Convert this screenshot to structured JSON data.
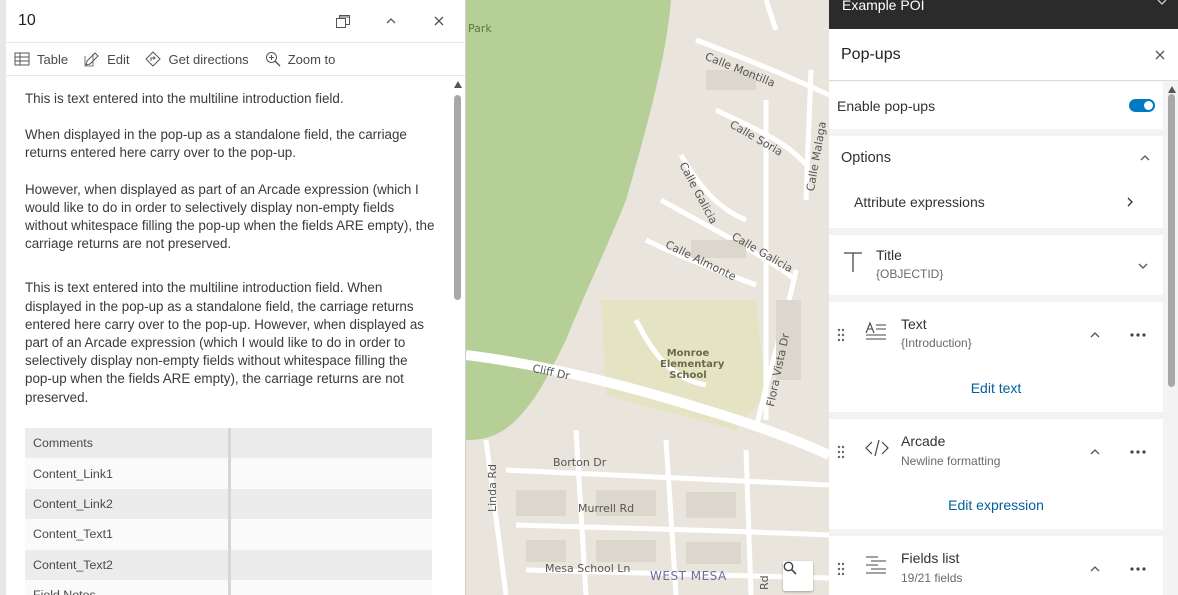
{
  "popup": {
    "title": "10",
    "toolbar": {
      "table": "Table",
      "edit": "Edit",
      "directions": "Get directions",
      "zoom": "Zoom to"
    },
    "intro_paragraphs": [
      "This is text entered into the multiline introduction field.",
      "When displayed in the pop-up as a standalone field, the carriage returns entered here carry over to the pop-up.",
      "However, when displayed as part of an Arcade expression (which I would like to do in order to selectively display non-empty fields without whitespace filling the pop-up when the fields ARE empty), the carriage returns are not preserved.",
      "This is text entered into the multiline introduction field. When displayed in the pop-up as a standalone field, the carriage returns entered here carry over to the pop-up. However, when displayed as part of an Arcade expression (which I would like to do in order to selectively display non-empty fields without whitespace filling the pop-up when the fields ARE empty), the carriage returns are not preserved."
    ],
    "fields": [
      {
        "name": "Comments",
        "value": ""
      },
      {
        "name": "Content_Link1",
        "value": ""
      },
      {
        "name": "Content_Link2",
        "value": ""
      },
      {
        "name": "Content_Text1",
        "value": ""
      },
      {
        "name": "Content_Text2",
        "value": ""
      },
      {
        "name": "Field Notes",
        "value": ""
      }
    ]
  },
  "map": {
    "labels": {
      "park": "Park",
      "calle_montilla": "Calle Montilla",
      "calle_soria": "Calle Soria",
      "calle_malaga": "Calle Malaga",
      "calle_galicia_v": "Calle Galicia",
      "calle_galicia": "Calle Galicia",
      "calle_almonte": "Calle Almonte",
      "flora_vista": "Flora Vista Dr",
      "school": "Monroe Elementary School",
      "cliff_dr": "Cliff Dr",
      "borton_dr": "Borton Dr",
      "linda_rd": "Linda Rd",
      "murrell_rd": "Murrell Rd",
      "mesa_school_ln": "Mesa School Ln",
      "west_mesa": "WEST MESA",
      "rd_bottom": "Rd"
    },
    "colors": {
      "park": "#b5cf96",
      "school": "#e4e3c4",
      "road": "#ffffff",
      "land": "#e9e5dc"
    }
  },
  "config": {
    "layer_name": "Example POI",
    "panel_title": "Pop-ups",
    "enable_label": "Enable pop-ups",
    "enable_on": true,
    "options_label": "Options",
    "attribute_expressions": "Attribute expressions",
    "elements": [
      {
        "title": "Title",
        "sub": "{OBJECTID}"
      },
      {
        "title": "Text",
        "sub": "{Introduction}",
        "action": "Edit text"
      },
      {
        "title": "Arcade",
        "sub": "Newline formatting",
        "action": "Edit expression"
      },
      {
        "title": "Fields list",
        "sub": "19/21 fields"
      }
    ],
    "accent": "#007ac2"
  }
}
